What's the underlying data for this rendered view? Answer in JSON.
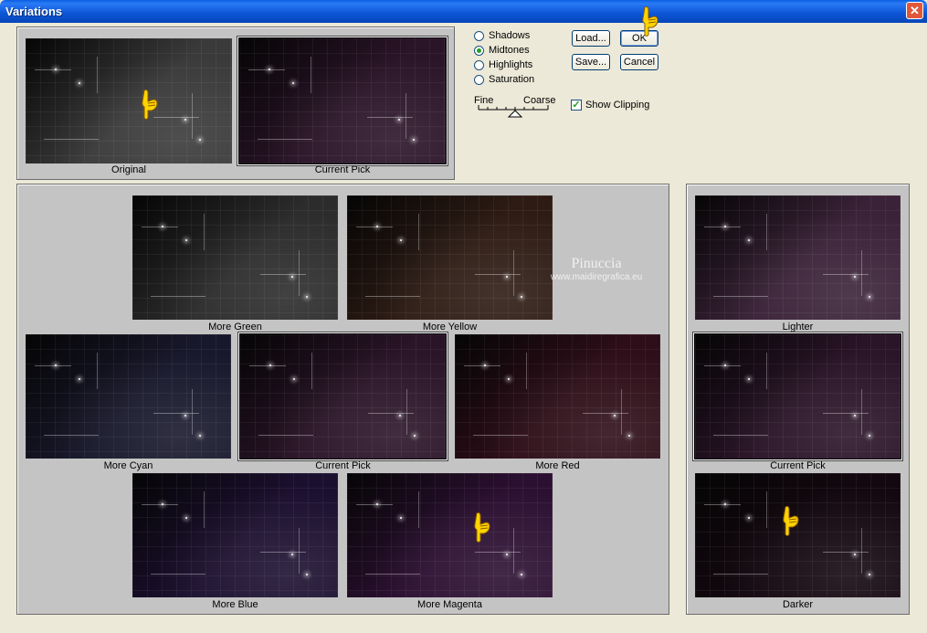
{
  "window": {
    "title": "Variations",
    "close_glyph": "✕"
  },
  "colors": {
    "original": "#3a3a3a",
    "current_pick": "#2a1428",
    "more_green": "#2c2c2c",
    "more_yellow": "#2e1c14",
    "more_cyan": "#18182c",
    "more_red": "#2e0e18",
    "more_blue": "#1c1030",
    "more_magenta": "#2c1032",
    "lighter": "#3a2238",
    "darker": "#140810"
  },
  "top_preview": {
    "original_label": "Original",
    "current_pick_label": "Current Pick"
  },
  "options": {
    "radios": [
      {
        "label": "Shadows",
        "selected": false
      },
      {
        "label": "Midtones",
        "selected": true
      },
      {
        "label": "Highlights",
        "selected": false
      },
      {
        "label": "Saturation",
        "selected": false
      }
    ],
    "slider_fine": "Fine",
    "slider_coarse": "Coarse",
    "show_clipping_label": "Show Clipping",
    "show_clipping_checked": true
  },
  "buttons": {
    "load": "Load...",
    "ok": "OK",
    "save": "Save...",
    "cancel": "Cancel"
  },
  "color_grid": {
    "more_green": "More Green",
    "more_yellow": "More Yellow",
    "more_cyan": "More Cyan",
    "current_pick": "Current Pick",
    "more_red": "More Red",
    "more_blue": "More Blue",
    "more_magenta": "More Magenta"
  },
  "brightness": {
    "lighter": "Lighter",
    "current_pick": "Current Pick",
    "darker": "Darker"
  },
  "watermark": {
    "line1": "Pinuccia",
    "line2": "www.maidiregrafica.eu"
  },
  "icons": {
    "pointer": "pointing-hand-icon"
  }
}
